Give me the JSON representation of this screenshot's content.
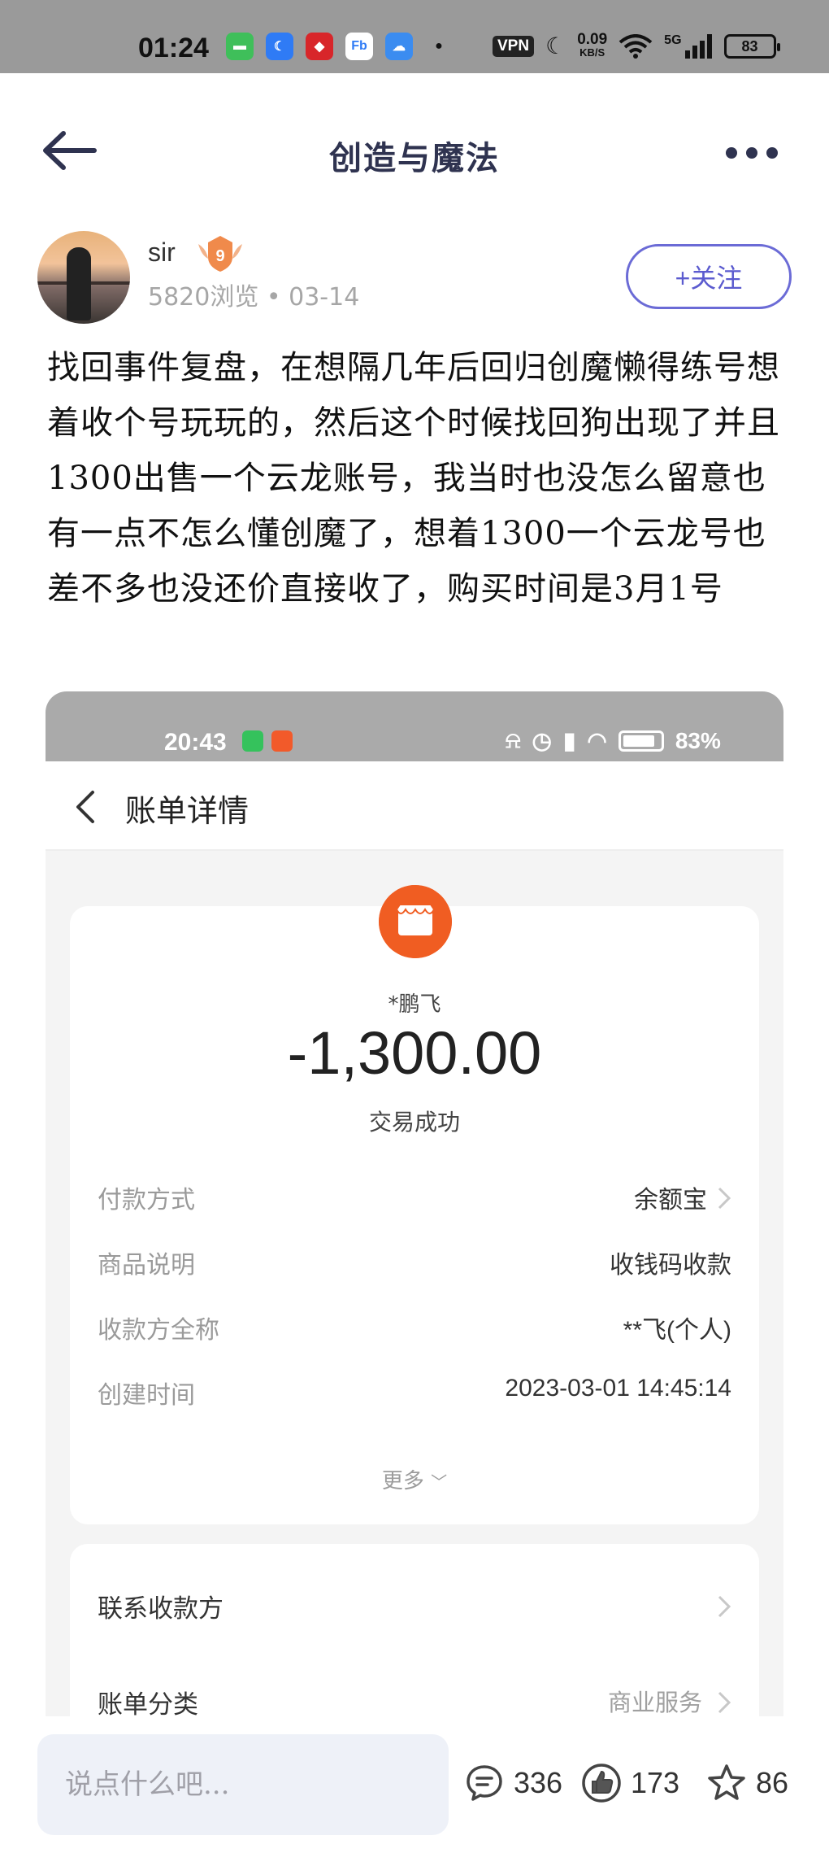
{
  "status_bar": {
    "time": "01:24",
    "vpn": "VPN",
    "speed_value": "0.09",
    "speed_unit": "KB/S",
    "signal": "5G",
    "battery": "83"
  },
  "header": {
    "title": "创造与魔法"
  },
  "author": {
    "name": "sir",
    "level": "9",
    "meta": "5820浏览 • 03-14",
    "follow_label": "+关注"
  },
  "post": {
    "text": "找回事件复盘，在想隔几年后回归创魔懒得练号想着收个号玩玩的，然后这个时候找回狗出现了并且1300出售一个云龙账号，我当时也没怎么留意也有一点不怎么懂创魔了，想着1300一个云龙号也差不多也没还价直接收了，购买时间是3月1号"
  },
  "embedded_screenshot": {
    "status_time": "20:43",
    "status_battery": "83%",
    "nav_title": "账单详情",
    "payee": "*鹏飞",
    "amount": "-1,300.00",
    "status": "交易成功",
    "details": [
      {
        "label": "付款方式",
        "value": "余额宝"
      },
      {
        "label": "商品说明",
        "value": "收钱码收款"
      },
      {
        "label": "收款方全称",
        "value": "**飞(个人)"
      },
      {
        "label": "创建时间",
        "value": "2023-03-01 14:45:14"
      }
    ],
    "more_label": "更多",
    "contact_label": "联系收款方",
    "category_label": "账单分类",
    "category_value": "商业服务"
  },
  "bottom_bar": {
    "comment_placeholder": "说点什么吧...",
    "comments": "336",
    "likes": "173",
    "favorites": "86"
  },
  "colors": {
    "accent": "#5b5bcf",
    "shop_orange": "#f05d22",
    "status_gray": "#9a9a9a"
  }
}
